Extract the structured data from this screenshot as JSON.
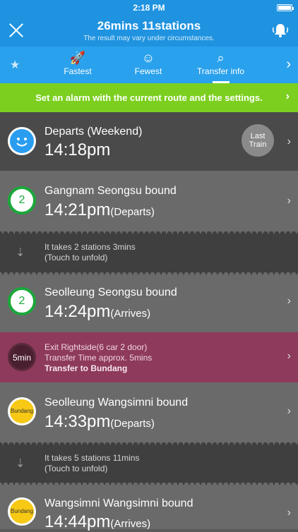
{
  "status": {
    "time": "2:18 PM"
  },
  "header": {
    "title": "26mins 11stations",
    "subtitle": "The result may vary under circumstances."
  },
  "tabs": [
    {
      "label": "Fastest",
      "icon": "rocket-icon"
    },
    {
      "label": "Fewest",
      "icon": "person-icon"
    },
    {
      "label": "Transfer info",
      "icon": "map-search-icon"
    }
  ],
  "alarm_banner": "Set an alarm with the current route and the settings.",
  "route": {
    "depart": {
      "name": "Departs (Weekend)",
      "time": "14:18pm",
      "badge": "Last Train"
    },
    "seg1": {
      "name": "Gangnam Seongsu bound",
      "time": "14:21pm",
      "suffix": "(Departs)",
      "line": "2"
    },
    "info1": {
      "line1": "It takes 2 stations 3mins",
      "line2": "(Touch to unfold)"
    },
    "seg2": {
      "name": "Seolleung Seongsu bound",
      "time": "14:24pm",
      "suffix": "(Arrives)",
      "line": "2"
    },
    "transfer": {
      "duration": "5min",
      "line1": "Exit Rightside(6 car 2 door)",
      "line2": "Transfer Time approx. 5mins",
      "line3": "Transfer to Bundang"
    },
    "seg3": {
      "name": "Seolleung Wangsimni bound",
      "time": "14:33pm",
      "suffix": "(Departs)",
      "line": "Bundang"
    },
    "info2": {
      "line1": "It takes 5 stations 11mins",
      "line2": "(Touch to unfold)"
    },
    "seg4": {
      "name": "Wangsimni Wangsimni bound",
      "time": "14:44pm",
      "suffix": "(Arrives)",
      "line": "Bundang"
    }
  }
}
